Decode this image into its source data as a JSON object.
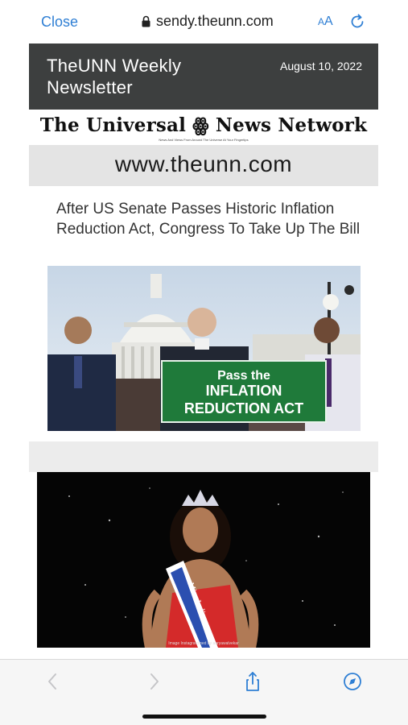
{
  "browser": {
    "close_label": "Close",
    "url": "sendy.theunn.com",
    "text_size_small": "A",
    "text_size_big": "A"
  },
  "newsletter": {
    "title": "TheUNN Weekly Newsletter",
    "date": "August 10, 2022",
    "logo_text": "The Universal ꙮ News Network",
    "logo_tagline": "News And Views From Around The Universe At Your Fingertips",
    "site_url": "www.theunn.com"
  },
  "articles": [
    {
      "headline": "After US Senate Passes Historic Inflation Reduction Act, Congress To Take Up The Bill",
      "image_sign": [
        "Pass the",
        "INFLATION",
        "REDUCTION ACT"
      ]
    },
    {
      "image_sash": "Miss India",
      "image_credit": "Image Instagrammed by aaryawalvekar"
    }
  ],
  "colors": {
    "accent": "#2f7fd4",
    "header_bg": "#3d3f3f",
    "url_band_bg": "#e4e4e4",
    "sign_green": "#1f7a3a"
  },
  "icons": {
    "lock": "lock-icon",
    "reload": "reload-icon",
    "back": "chevron-left-icon",
    "forward": "chevron-right-icon",
    "share": "share-icon",
    "bookmarks": "compass-icon"
  }
}
